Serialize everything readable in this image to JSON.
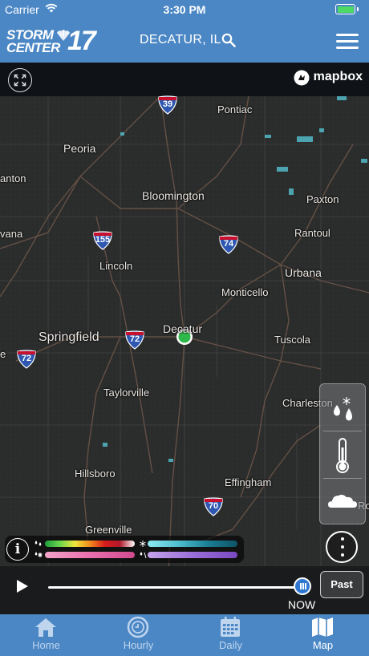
{
  "status_bar": {
    "carrier": "Carrier",
    "time": "3:30 PM"
  },
  "header": {
    "logo_word1": "STORM",
    "logo_word2": "CENTER",
    "logo_number": "17",
    "location": "DECATUR, IL"
  },
  "map": {
    "attribution": "mapbox",
    "cities": [
      "Pontiac",
      "Peoria",
      "anton",
      "Bloomington",
      "Paxton",
      "vana",
      "Rantoul",
      "Lincoln",
      "Urbana",
      "Monticello",
      "Springfield",
      "Decatur",
      "Tuscola",
      "e",
      "Taylorville",
      "Charleston",
      "Hillsboro",
      "Effingham",
      "Greenville",
      "Ro"
    ],
    "highways": [
      "39",
      "155",
      "74",
      "72",
      "72",
      "70"
    ]
  },
  "timeline": {
    "current_label": "NOW",
    "past_button": "Past"
  },
  "tabs": [
    {
      "label": "Home",
      "icon": "home-icon",
      "active": false
    },
    {
      "label": "Hourly",
      "icon": "clock-icon",
      "active": false
    },
    {
      "label": "Daily",
      "icon": "calendar-icon",
      "active": false
    },
    {
      "label": "Map",
      "icon": "map-icon",
      "active": true
    }
  ],
  "colors": {
    "brand_blue": "#4b87c5",
    "slider_blue": "#2f77d1",
    "location_dot": "#2fb84a"
  }
}
